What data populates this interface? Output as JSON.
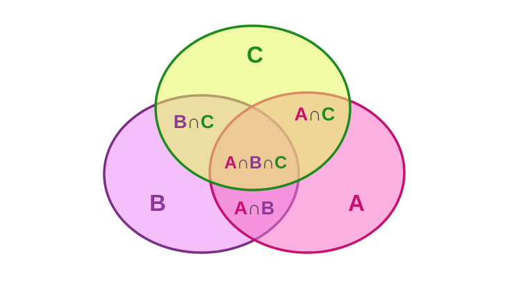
{
  "diagram": {
    "sets": [
      {
        "id": "C",
        "label": "C",
        "fill": "#e6f55a",
        "stroke": "#1f8a1f",
        "label_color": "#1f8a1f"
      },
      {
        "id": "B",
        "label": "B",
        "fill": "#eb8af5",
        "stroke": "#7a2f86",
        "label_color": "#8a3a96"
      },
      {
        "id": "A",
        "label": "A",
        "fill": "#f570c8",
        "stroke": "#c8106e",
        "label_color": "#c8106e"
      }
    ],
    "intersection_symbol": "∩",
    "symbol_color": "#444444",
    "regions": {
      "b_and_c": {
        "left": "B",
        "right": "C"
      },
      "a_and_c": {
        "left": "A",
        "right": "C"
      },
      "a_and_b": {
        "left": "A",
        "right": "B"
      },
      "a_and_b_and_c": {
        "first": "A",
        "second": "B",
        "third": "C"
      }
    }
  }
}
